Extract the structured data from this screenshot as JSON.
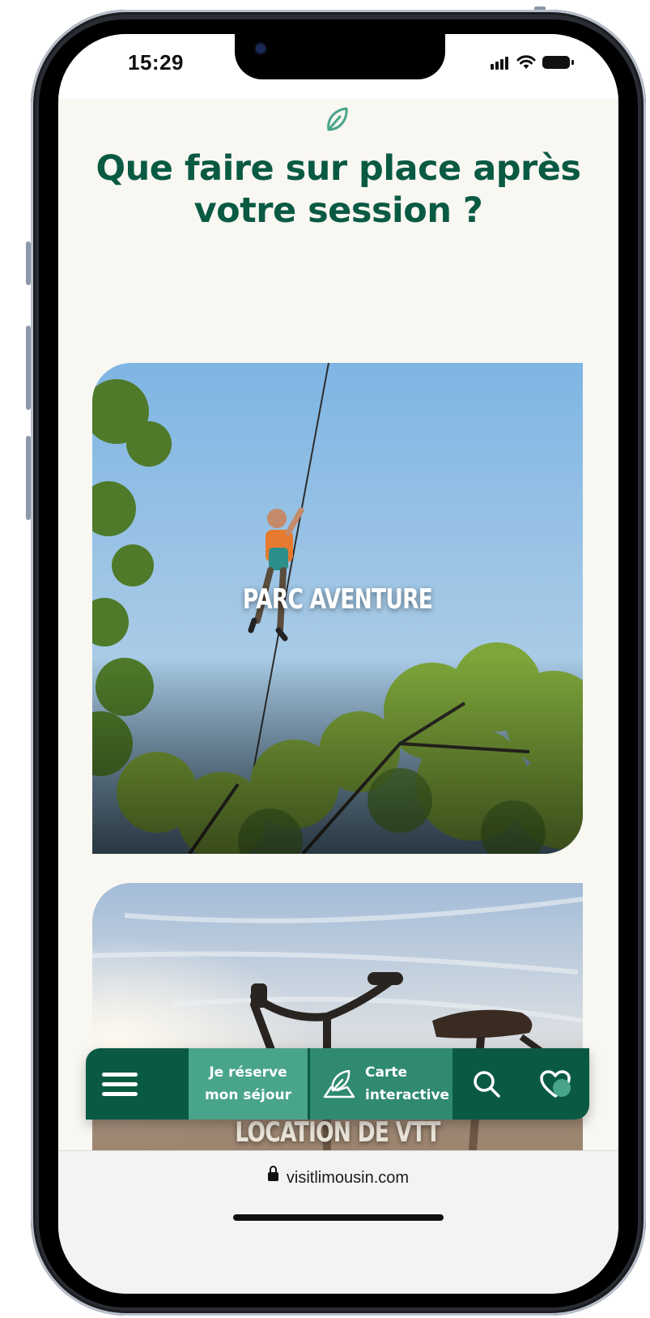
{
  "status_bar": {
    "time": "15:29",
    "signal_icon": "cellular-signal-icon",
    "wifi_icon": "wifi-icon",
    "battery_icon": "battery-icon"
  },
  "section": {
    "icon": "leaf-icon",
    "title": "Que faire sur place après votre session ?"
  },
  "cards": [
    {
      "title": "PARC AVENTURE"
    },
    {
      "title": "LOCATION DE VTT"
    }
  ],
  "bottom_nav": {
    "menu_icon": "hamburger-menu-icon",
    "reserve_line1": "Je réserve",
    "reserve_line2": "mon séjour",
    "map_icon": "map-leaf-icon",
    "map_line1": "Carte",
    "map_line2": "interactive",
    "search_icon": "search-icon",
    "favorites_icon": "heart-icon"
  },
  "browser": {
    "url": "visitlimousin.com"
  },
  "colors": {
    "brand_green": "#0a5a43",
    "accent_green": "#48a48a",
    "background": "#f8f7f2"
  }
}
